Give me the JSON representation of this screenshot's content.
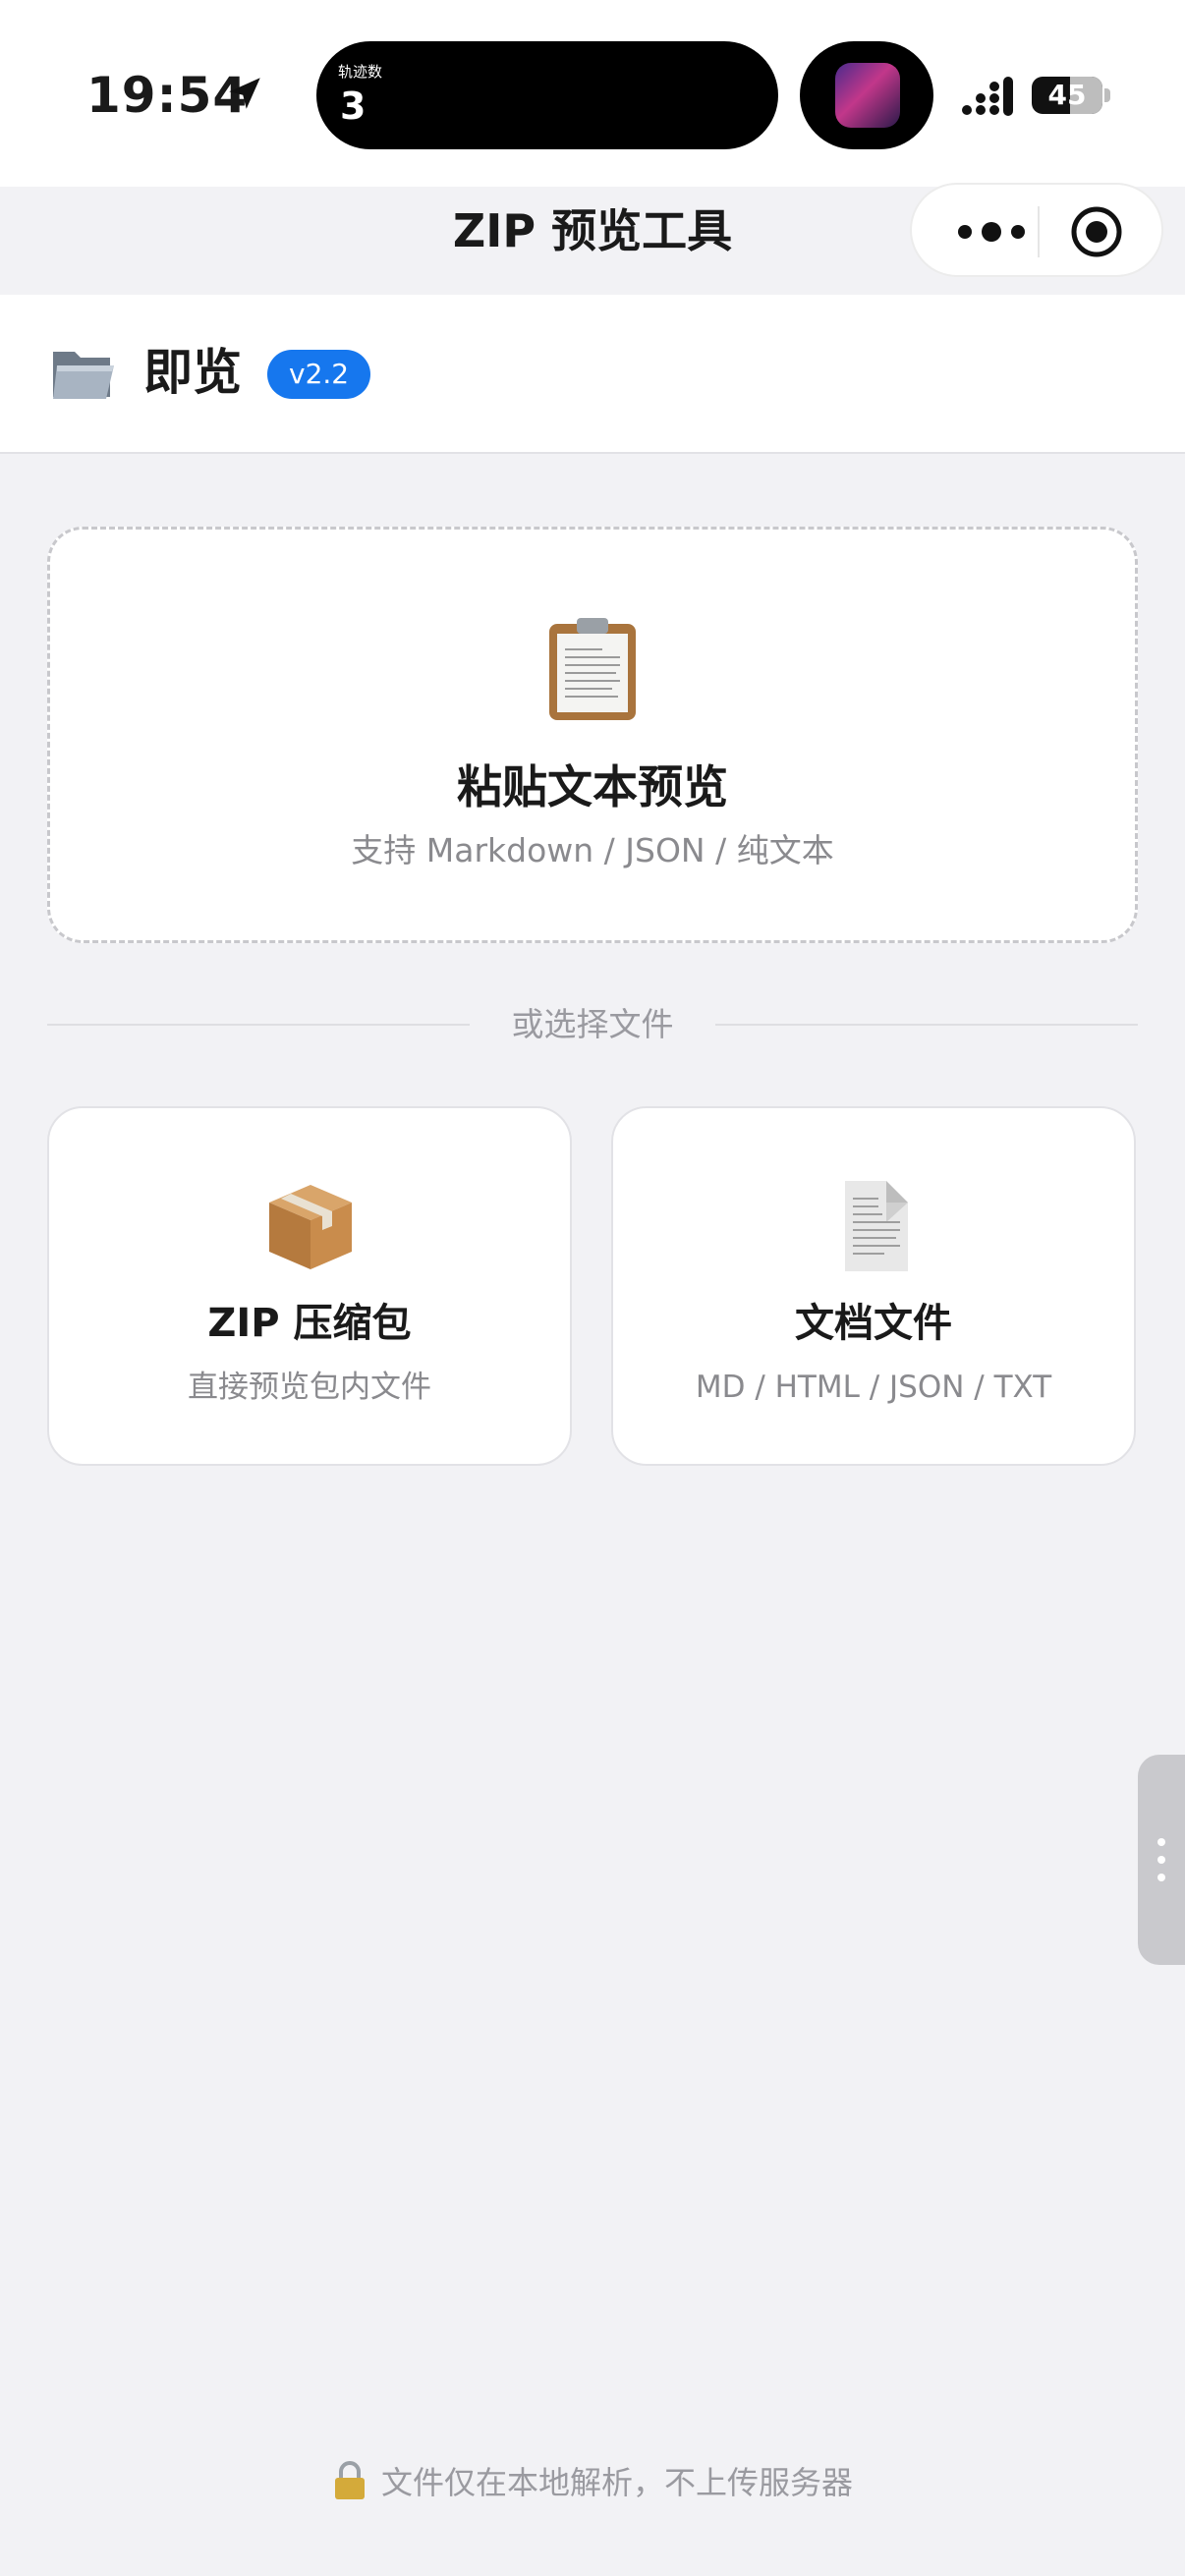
{
  "status_bar": {
    "time": "19:54",
    "island_label": "轨迹数",
    "island_value": "3",
    "battery": "45"
  },
  "nav": {
    "title": "ZIP 预览工具"
  },
  "header": {
    "brand": "即览",
    "version": "v2.2"
  },
  "paste_card": {
    "title": "粘贴文本预览",
    "subtitle": "支持 Markdown / JSON / 纯文本"
  },
  "divider": {
    "label": "或选择文件"
  },
  "file_cards": [
    {
      "title": "ZIP 压缩包",
      "subtitle": "直接预览包内文件",
      "icon": "package-icon"
    },
    {
      "title": "文档文件",
      "subtitle": "MD / HTML / JSON / TXT",
      "icon": "document-icon"
    }
  ],
  "footer": {
    "note": "文件仅在本地解析，不上传服务器"
  },
  "colors": {
    "accent": "#1677ee",
    "background": "#f2f2f5",
    "muted_text": "#8a8a8e"
  }
}
